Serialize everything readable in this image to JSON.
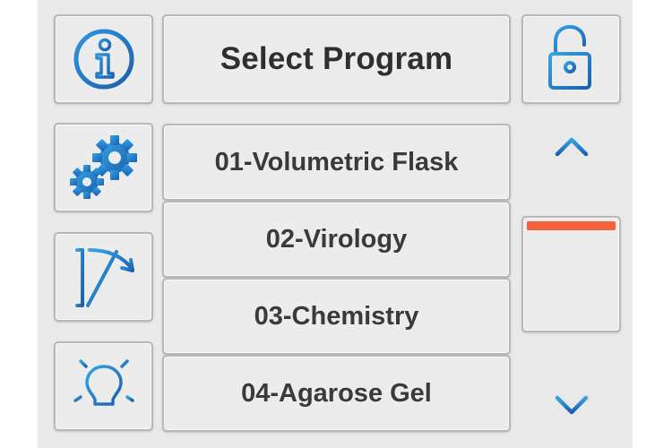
{
  "header": {
    "title": "Select Program"
  },
  "side_buttons": [
    {
      "name": "info-button",
      "icon": "info-icon"
    },
    {
      "name": "settings-button",
      "icon": "gears-icon"
    },
    {
      "name": "calibrate-button",
      "icon": "calibration-icon"
    },
    {
      "name": "tips-button",
      "icon": "lightbulb-icon"
    }
  ],
  "programs": [
    {
      "label": "01-Volumetric Flask"
    },
    {
      "label": "02-Virology"
    },
    {
      "label": "03-Chemistry"
    },
    {
      "label": "04-Agarose Gel"
    }
  ],
  "right_controls": {
    "lock_icon": "unlock-icon",
    "up_icon": "arrow-up-icon",
    "down_icon": "arrow-down-icon",
    "scroll_position": 0
  },
  "colors": {
    "accent_blue": "#1f6fc0",
    "accent_blue_light": "#2f95dc",
    "scroll_thumb": "#f4613a",
    "panel_bg": "#e9e9e9"
  }
}
